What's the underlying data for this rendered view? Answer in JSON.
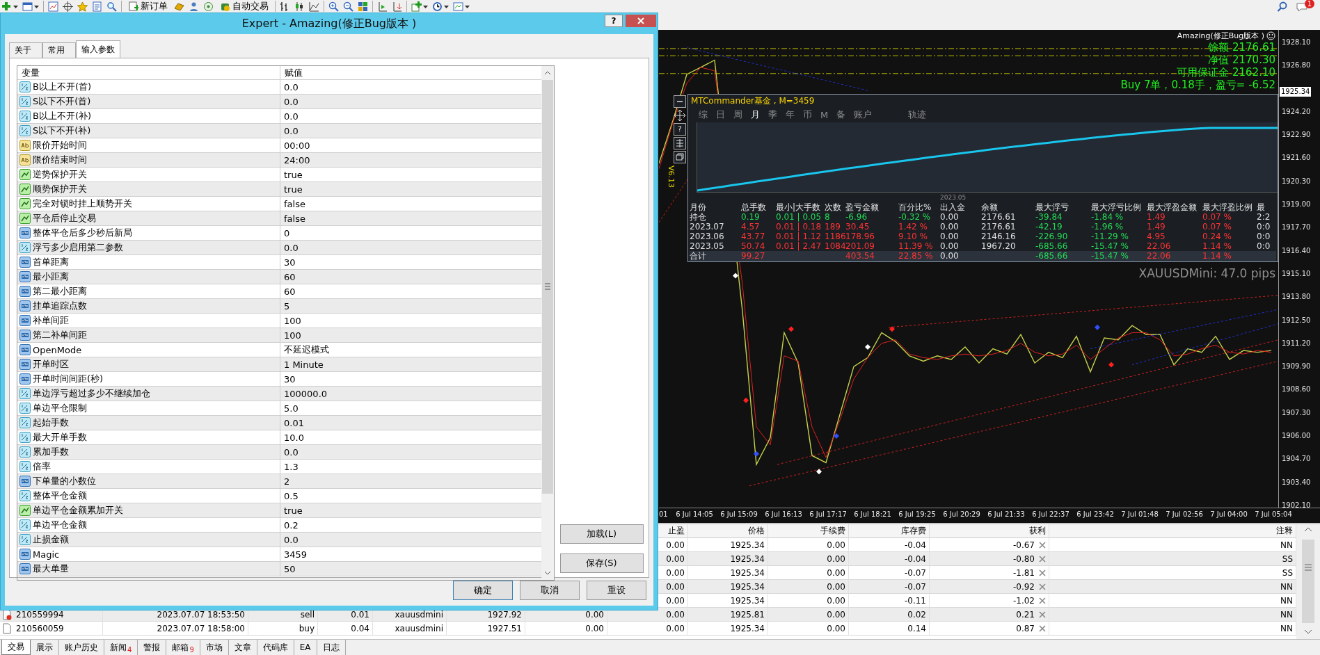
{
  "toolbar": {
    "buttons": [
      {
        "label": "新订单"
      },
      {
        "label": "自动交易"
      }
    ],
    "notification_count": "1"
  },
  "chart": {
    "ea_label": "Amazing(修正Bug版本 )",
    "account_lines": [
      "馀额 2176.61",
      "净值 2170.30",
      "可用保证金 2162.10",
      "Buy 7单，0.18手，盈亏= -6.52"
    ],
    "version": "V6.13",
    "pips": "XAUUSDMini: 47.0 pips",
    "current_price": "1925.34",
    "time_labels": [
      "01",
      "6 Jul 14:05",
      "6 Jul 15:09",
      "6 Jul 16:13",
      "6 Jul 17:17",
      "6 Jul 18:21",
      "6 Jul 19:25",
      "6 Jul 20:29",
      "6 Jul 21:33",
      "6 Jul 22:37",
      "6 Jul 23:42",
      "7 Jul 01:48",
      "7 Jul 02:56",
      "7 Jul 04:00",
      "7 Jul 05:04"
    ],
    "chart_data": {
      "type": "line",
      "ylim": [
        1901.98,
        1928.8
      ],
      "yticks": [
        {
          "value": 1928.1,
          "label": "1928.10"
        },
        {
          "value": 1926.8,
          "label": "1926.80"
        },
        {
          "value": 1924.2,
          "label": "1924.20"
        },
        {
          "value": 1922.9,
          "label": "1922.90"
        },
        {
          "value": 1921.6,
          "label": "1921.60"
        },
        {
          "value": 1920.3,
          "label": "1920.30"
        },
        {
          "value": 1919.0,
          "label": "1919.00"
        },
        {
          "value": 1917.7,
          "label": "1917.70"
        },
        {
          "value": 1916.4,
          "label": "1916.40"
        },
        {
          "value": 1915.1,
          "label": "1915.10"
        },
        {
          "value": 1913.8,
          "label": "1913.80"
        },
        {
          "value": 1912.5,
          "label": "1912.50"
        },
        {
          "value": 1911.2,
          "label": "1911.20"
        },
        {
          "value": 1909.9,
          "label": "1909.90"
        },
        {
          "value": 1908.6,
          "label": "1908.60"
        },
        {
          "value": 1907.3,
          "label": "1907.30"
        },
        {
          "value": 1906.0,
          "label": "1906.00"
        },
        {
          "value": 1904.7,
          "label": "1904.70"
        },
        {
          "value": 1903.4,
          "label": "1903.40"
        },
        {
          "value": 1902.1,
          "label": "1902.10"
        }
      ],
      "series": [
        {
          "color": "#c6d04a",
          "values": [
            1921.3,
            1923.7,
            1926.3,
            1926.7,
            1927.1,
            null,
            1913.0,
            1904.4,
            1905.9,
            1911.8,
            1910.1,
            1904.9,
            1904.5,
            1907.2,
            1909.9,
            1910.4,
            1911.8,
            1911.3,
            1910.5,
            1910.2,
            1910.5,
            1910.3,
            1911.0,
            1910.1,
            1910.9,
            1910.6,
            1911.7,
            1910.1,
            1910.7,
            1910.4,
            1911.6,
            1909.6,
            1911.5,
            1911.4,
            1912.2,
            1911.7,
            1911.7,
            1910.0,
            1910.9,
            1910.7,
            1911.6,
            1910.3,
            1910.8,
            1910.7,
            1910.8
          ]
        },
        {
          "color": "#e02020",
          "values": [
            1921.0,
            1923.6,
            1925.8,
            1926.7,
            1926.5,
            null,
            1914.5,
            1906.5,
            1905.5,
            1910.5,
            1910.2,
            1906.5,
            1904.8,
            1906.9,
            1909.2,
            1910.4,
            1911.2,
            1911.4,
            1910.6,
            1910.4,
            1910.3,
            1910.5,
            1910.6,
            1910.5,
            1910.6,
            1910.8,
            1911.2,
            1910.7,
            1910.5,
            1910.6,
            1911.1,
            1910.3,
            1910.9,
            1911.5,
            1911.8,
            1911.8,
            1911.4,
            1910.5,
            1910.6,
            1910.9,
            1911.1,
            1910.7,
            1910.6,
            1910.8,
            1910.7
          ]
        }
      ]
    }
  },
  "commander": {
    "title": "MTCommander基金 , M=3459",
    "side_help": "?",
    "tabs": [
      {
        "label": "综",
        "selected": false
      },
      {
        "label": "日",
        "selected": false
      },
      {
        "label": "周",
        "selected": false
      },
      {
        "label": "月",
        "selected": true
      },
      {
        "label": "季",
        "selected": false
      },
      {
        "label": "年",
        "selected": false
      },
      {
        "label": "币",
        "selected": false
      },
      {
        "label": "M",
        "selected": false
      },
      {
        "label": "备",
        "selected": false
      },
      {
        "label": "账户",
        "selected": false
      },
      {
        "label": "轨迹",
        "selected": false
      }
    ],
    "axis_label": "2023.05",
    "columns": [
      "月份",
      "总手数",
      "最小|大手数",
      "次数",
      "盈亏金额",
      "百分比%",
      "出入金",
      "余额",
      "最大浮亏",
      "最大浮亏比例",
      "最大浮盈金额",
      "最大浮盈比例",
      "最"
    ],
    "rows": [
      {
        "kind": "open",
        "cells": [
          {
            "text": "持仓"
          },
          {
            "text": "0.19",
            "color": "#22dd55"
          },
          {
            "text": "0.01 | 0.05",
            "color": "#22dd55"
          },
          {
            "text": "8",
            "color": "#22dd55"
          },
          {
            "text": "-6.96",
            "color": "#22dd55"
          },
          {
            "text": "-0.32 %",
            "color": "#22dd55"
          },
          {
            "text": "0.00"
          },
          {
            "text": "2176.61"
          },
          {
            "text": "-39.84",
            "color": "#22dd55"
          },
          {
            "text": "-1.84 %",
            "color": "#22dd55"
          },
          {
            "text": "1.49",
            "color": "#ff3333"
          },
          {
            "text": "0.07 %",
            "color": "#ff3333"
          },
          {
            "text": "2:2"
          }
        ]
      },
      {
        "kind": "month",
        "cells": [
          {
            "text": "2023.07"
          },
          {
            "text": "4.57",
            "color": "#ff3333"
          },
          {
            "text": "0.01 | 0.18",
            "color": "#ff3333"
          },
          {
            "text": "189",
            "color": "#ff3333"
          },
          {
            "text": "30.45",
            "color": "#ff3333"
          },
          {
            "text": "1.42 %",
            "color": "#ff3333"
          },
          {
            "text": "0.00"
          },
          {
            "text": "2176.61"
          },
          {
            "text": "-42.19",
            "color": "#22dd55"
          },
          {
            "text": "-1.96 %",
            "color": "#22dd55"
          },
          {
            "text": "1.49",
            "color": "#ff3333"
          },
          {
            "text": "0.07 %",
            "color": "#ff3333"
          },
          {
            "text": "0:0"
          }
        ]
      },
      {
        "kind": "month",
        "cells": [
          {
            "text": "2023.06"
          },
          {
            "text": "43.77",
            "color": "#ff3333"
          },
          {
            "text": "0.01 | 1.12",
            "color": "#ff3333"
          },
          {
            "text": "1186",
            "color": "#ff3333"
          },
          {
            "text": "178.96",
            "color": "#ff3333"
          },
          {
            "text": "9.10 %",
            "color": "#ff3333"
          },
          {
            "text": "0.00"
          },
          {
            "text": "2146.16"
          },
          {
            "text": "-226.90",
            "color": "#22dd55"
          },
          {
            "text": "-11.29 %",
            "color": "#22dd55"
          },
          {
            "text": "4.95",
            "color": "#ff3333"
          },
          {
            "text": "0.24 %",
            "color": "#ff3333"
          },
          {
            "text": "0:0"
          }
        ]
      },
      {
        "kind": "month",
        "cells": [
          {
            "text": "2023.05"
          },
          {
            "text": "50.74",
            "color": "#ff3333"
          },
          {
            "text": "0.01 | 2.47",
            "color": "#ff3333"
          },
          {
            "text": "1084",
            "color": "#ff3333"
          },
          {
            "text": "201.09",
            "color": "#ff3333"
          },
          {
            "text": "11.39 %",
            "color": "#ff3333"
          },
          {
            "text": "0.00"
          },
          {
            "text": "1967.20"
          },
          {
            "text": "-685.66",
            "color": "#22dd55"
          },
          {
            "text": "-15.47 %",
            "color": "#22dd55"
          },
          {
            "text": "22.06",
            "color": "#ff3333"
          },
          {
            "text": "1.14 %",
            "color": "#ff3333"
          },
          {
            "text": "0:0"
          }
        ]
      },
      {
        "kind": "total",
        "cells": [
          {
            "text": "合计"
          },
          {
            "text": "99.27",
            "color": "#ff3333"
          },
          null,
          null,
          {
            "text": "403.54",
            "color": "#ff3333"
          },
          {
            "text": "22.85 %",
            "color": "#ff3333"
          },
          {
            "text": "0.00"
          },
          null,
          {
            "text": "-685.66",
            "color": "#22dd55"
          },
          {
            "text": "-15.47 %",
            "color": "#22dd55"
          },
          {
            "text": "22.06",
            "color": "#ff3333"
          },
          {
            "text": "1.14 %",
            "color": "#ff3333"
          },
          null
        ]
      }
    ]
  },
  "terminal": {
    "columns": [
      "",
      "",
      "",
      "",
      "",
      "",
      "",
      "止盈",
      "价格",
      "手续费",
      "库存费",
      "获利",
      "注释"
    ],
    "rows": [
      {
        "cells": [
          null,
          null,
          null,
          null,
          null,
          null,
          null,
          "0.00",
          "1925.34",
          "0.00",
          "-0.04",
          "-0.67",
          "NN"
        ]
      },
      {
        "cells": [
          null,
          null,
          null,
          null,
          null,
          null,
          null,
          "0.00",
          "1925.34",
          "0.00",
          "-0.04",
          "-0.80",
          "SS"
        ]
      },
      {
        "cells": [
          null,
          null,
          null,
          null,
          null,
          null,
          null,
          "0.00",
          "1925.34",
          "0.00",
          "-0.07",
          "-1.81",
          "SS"
        ]
      },
      {
        "cells": [
          null,
          null,
          null,
          null,
          null,
          null,
          null,
          "0.00",
          "1925.34",
          "0.00",
          "-0.07",
          "-0.92",
          "NN"
        ]
      },
      {
        "cells": [
          null,
          null,
          null,
          null,
          null,
          null,
          null,
          "0.00",
          "1925.34",
          "0.00",
          "-0.11",
          "-1.02",
          "NN"
        ]
      },
      {
        "alert": true,
        "cells": [
          "210559994",
          "2023.07.07 18:53:50",
          "sell",
          "0.01",
          "xauusdmini",
          "1927.92",
          "0.00",
          "0.00",
          "1925.81",
          "0.00",
          "0.02",
          "0.21",
          "NN"
        ]
      },
      {
        "alert": false,
        "cells": [
          "210560059",
          "2023.07.07 18:58:00",
          "buy",
          "0.04",
          "xauusdmini",
          "1927.51",
          "0.00",
          "0.00",
          "1925.34",
          "0.00",
          "0.14",
          "0.87",
          "NN"
        ]
      }
    ]
  },
  "bottom_tabs": [
    {
      "label": "交易",
      "selected": true
    },
    {
      "label": "展示",
      "selected": false
    },
    {
      "label": "账户历史",
      "selected": false
    },
    {
      "label": "新闻",
      "badge": "4",
      "selected": false
    },
    {
      "label": "警报",
      "selected": false
    },
    {
      "label": "邮箱",
      "badge": "9",
      "selected": false
    },
    {
      "label": "市场",
      "selected": false
    },
    {
      "label": "文章",
      "selected": false
    },
    {
      "label": "代码库",
      "selected": false
    },
    {
      "label": "EA",
      "selected": false
    },
    {
      "label": "日志",
      "selected": false
    }
  ],
  "dialog": {
    "title": "Expert - Amazing(修正Bug版本 )",
    "help": "?",
    "tabs": [
      {
        "label": "关于",
        "selected": false
      },
      {
        "label": "常用",
        "selected": false
      },
      {
        "label": "输入参数",
        "selected": true
      }
    ],
    "columns": [
      "变量",
      "赋值"
    ],
    "params": [
      {
        "kind": "double",
        "name": "B以上不开(首)",
        "value": "0.0"
      },
      {
        "kind": "double",
        "name": "S以下不开(首)",
        "value": "0.0"
      },
      {
        "kind": "double",
        "name": "B以上不开(补)",
        "value": "0.0"
      },
      {
        "kind": "double",
        "name": "S以下不开(补)",
        "value": "0.0"
      },
      {
        "kind": "string",
        "name": "限价开始时间",
        "value": "00:00"
      },
      {
        "kind": "string",
        "name": "限价结束时间",
        "value": "24:00"
      },
      {
        "kind": "bool",
        "name": "逆势保护开关",
        "value": "true"
      },
      {
        "kind": "bool",
        "name": "顺势保护开关",
        "value": "true"
      },
      {
        "kind": "bool",
        "name": "完全对锁时挂上顺势开关",
        "value": "false"
      },
      {
        "kind": "bool",
        "name": "平仓后停止交易",
        "value": "false"
      },
      {
        "kind": "int",
        "name": "整体平仓后多少秒后新局",
        "value": "0"
      },
      {
        "kind": "double",
        "name": "浮亏多少启用第二参数",
        "value": "0.0"
      },
      {
        "kind": "int",
        "name": "首单距离",
        "value": "30"
      },
      {
        "kind": "int",
        "name": "最小距离",
        "value": "60"
      },
      {
        "kind": "int",
        "name": "第二最小距离",
        "value": "60"
      },
      {
        "kind": "int",
        "name": "挂单追踪点数",
        "value": "5"
      },
      {
        "kind": "int",
        "name": "补单间距",
        "value": "100"
      },
      {
        "kind": "int",
        "name": "第二补单间距",
        "value": "100"
      },
      {
        "kind": "int",
        "name": "OpenMode",
        "value": "不延迟模式"
      },
      {
        "kind": "int",
        "name": "开单时区",
        "value": "1 Minute"
      },
      {
        "kind": "int",
        "name": "开单时间间距(秒)",
        "value": "30"
      },
      {
        "kind": "double",
        "name": "单边浮亏超过多少不继续加仓",
        "value": "100000.0"
      },
      {
        "kind": "double",
        "name": "单边平仓限制",
        "value": "5.0"
      },
      {
        "kind": "double",
        "name": "起始手数",
        "value": "0.01"
      },
      {
        "kind": "double",
        "name": "最大开单手数",
        "value": "10.0"
      },
      {
        "kind": "double",
        "name": "累加手数",
        "value": "0.0"
      },
      {
        "kind": "double",
        "name": "倍率",
        "value": "1.3"
      },
      {
        "kind": "int",
        "name": "下单量的小数位",
        "value": "2"
      },
      {
        "kind": "double",
        "name": "整体平仓金额",
        "value": "0.5"
      },
      {
        "kind": "bool",
        "name": "单边平仓金额累加开关",
        "value": "true"
      },
      {
        "kind": "double",
        "name": "单边平仓金额",
        "value": "0.2"
      },
      {
        "kind": "double",
        "name": "止损金额",
        "value": "0.0"
      },
      {
        "kind": "int",
        "name": "Magic",
        "value": "3459"
      },
      {
        "kind": "int",
        "name": "最大单量",
        "value": "50"
      }
    ],
    "side_buttons": [
      "加载(L)",
      "保存(S)"
    ],
    "buttons": [
      "确定",
      "取消",
      "重设"
    ]
  }
}
